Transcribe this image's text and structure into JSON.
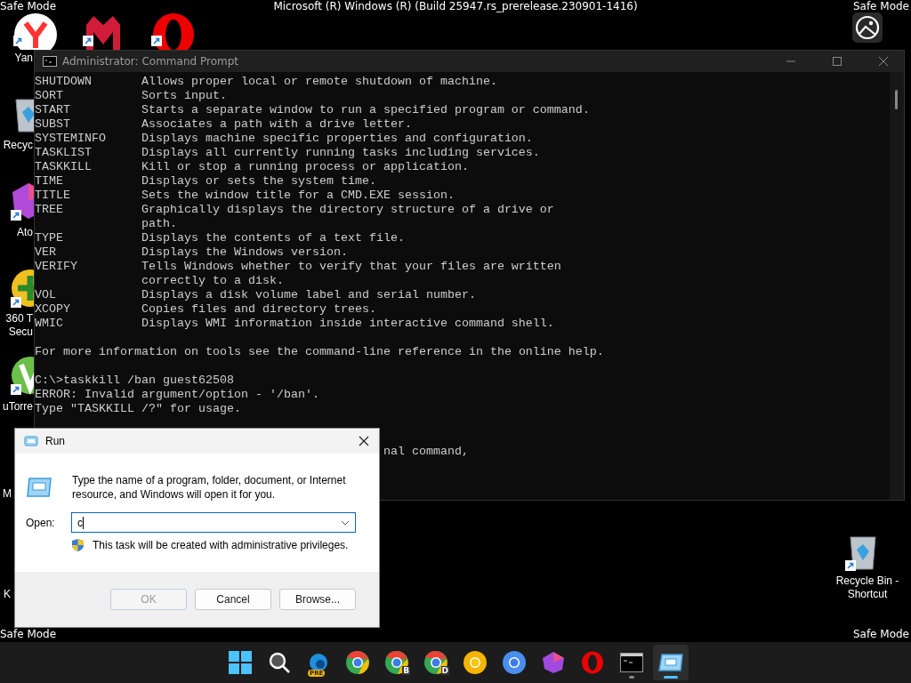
{
  "safe_mode_labels": [
    "Safe Mode",
    "Safe Mode",
    "Safe Mode",
    "Safe Mode"
  ],
  "system_title": "Microsoft (R) Windows (R) (Build 25947.rs_prerelease.230901-1416)",
  "desktop_icons": [
    {
      "kind": "yandex",
      "label_lines": [
        "Yan"
      ],
      "shortcut": true
    },
    {
      "kind": "m-logo",
      "shortcut": true
    },
    {
      "kind": "opera",
      "shortcut": true
    },
    {
      "kind": "recycle",
      "label_lines": [
        "Recyc"
      ],
      "shortcut": false
    },
    {
      "kind": "hexagon",
      "label_lines": [
        "Ato"
      ],
      "shortcut": true
    },
    {
      "kind": "shield360",
      "label_lines": [
        "360 T",
        "Secu"
      ],
      "shortcut": true
    },
    {
      "kind": "utorrent",
      "label_lines": [
        "uTorre"
      ],
      "shortcut": true
    },
    {
      "kind": "hidden",
      "label_lines": [
        "M"
      ]
    },
    {
      "kind": "hidden",
      "label_lines": [
        "K"
      ]
    },
    {
      "kind": "recycle",
      "label_lines": [
        "Recycle Bin -",
        "Shortcut"
      ],
      "shortcut": true
    }
  ],
  "console": {
    "title": "Administrator: Command Prompt",
    "lines": [
      {
        "kind": "entry",
        "name": "SHUTDOWN",
        "text": "Allows proper local or remote shutdown of machine."
      },
      {
        "kind": "entry",
        "name": "SORT",
        "text": "Sorts input."
      },
      {
        "kind": "entry",
        "name": "START",
        "text": "Starts a separate window to run a specified program or command."
      },
      {
        "kind": "entry",
        "name": "SUBST",
        "text": "Associates a path with a drive letter."
      },
      {
        "kind": "entry",
        "name": "SYSTEMINFO",
        "text": "Displays machine specific properties and configuration."
      },
      {
        "kind": "entry",
        "name": "TASKLIST",
        "text": "Displays all currently running tasks including services."
      },
      {
        "kind": "entry",
        "name": "TASKKILL",
        "text": "Kill or stop a running process or application."
      },
      {
        "kind": "entry",
        "name": "TIME",
        "text": "Displays or sets the system time."
      },
      {
        "kind": "entry",
        "name": "TITLE",
        "text": "Sets the window title for a CMD.EXE session."
      },
      {
        "kind": "entry",
        "name": "TREE",
        "text": "Graphically displays the directory structure of a drive or"
      },
      {
        "kind": "continuation",
        "text": "path."
      },
      {
        "kind": "entry",
        "name": "TYPE",
        "text": "Displays the contents of a text file."
      },
      {
        "kind": "entry",
        "name": "VER",
        "text": "Displays the Windows version."
      },
      {
        "kind": "entry",
        "name": "VERIFY",
        "text": "Tells Windows whether to verify that your files are written"
      },
      {
        "kind": "continuation",
        "text": "correctly to a disk."
      },
      {
        "kind": "entry",
        "name": "VOL",
        "text": "Displays a disk volume label and serial number."
      },
      {
        "kind": "entry",
        "name": "XCOPY",
        "text": "Copies files and directory trees."
      },
      {
        "kind": "entry",
        "name": "WMIC",
        "text": "Displays WMI information inside interactive command shell."
      },
      {
        "kind": "blank"
      },
      {
        "kind": "text",
        "text": "For more information on tools see the command-line reference in the online help."
      },
      {
        "kind": "blank"
      },
      {
        "kind": "text",
        "text": "C:\\>taskkill /ban guest62508"
      },
      {
        "kind": "text",
        "text": "ERROR: Invalid argument/option - '/ban'."
      },
      {
        "kind": "text",
        "text": "Type \"TASKKILL /?\" for usage."
      },
      {
        "kind": "blank"
      },
      {
        "kind": "blank"
      },
      {
        "kind": "covered",
        "text": "nal command,"
      }
    ]
  },
  "run_dialog": {
    "title": "Run",
    "description": "Type the name of a program, folder, document, or Internet resource, and Windows will open it for you.",
    "open_label": "Open:",
    "open_value": "c",
    "admin_note": "This task will be created with administrative privileges.",
    "buttons": [
      {
        "label": "OK",
        "disabled": true
      },
      {
        "label": "Cancel",
        "disabled": false
      },
      {
        "label": "Browse...",
        "disabled": false
      }
    ]
  },
  "taskbar": [
    {
      "kind": "start",
      "running": false,
      "selected": false
    },
    {
      "kind": "search",
      "running": false,
      "selected": false
    },
    {
      "kind": "edge",
      "badge": "PRE",
      "running": false,
      "selected": false
    },
    {
      "kind": "chrome",
      "running": false,
      "selected": false
    },
    {
      "kind": "chrome",
      "badge": "B",
      "running": false,
      "selected": false
    },
    {
      "kind": "chrome",
      "badge": "D",
      "running": false,
      "selected": false
    },
    {
      "kind": "canary",
      "running": false,
      "selected": false
    },
    {
      "kind": "chromium",
      "running": false,
      "selected": false
    },
    {
      "kind": "hexagon",
      "running": false,
      "selected": false
    },
    {
      "kind": "opera",
      "running": false,
      "selected": false
    },
    {
      "kind": "terminal",
      "running": true,
      "selected": false
    },
    {
      "kind": "run",
      "running": true,
      "selected": true
    }
  ]
}
